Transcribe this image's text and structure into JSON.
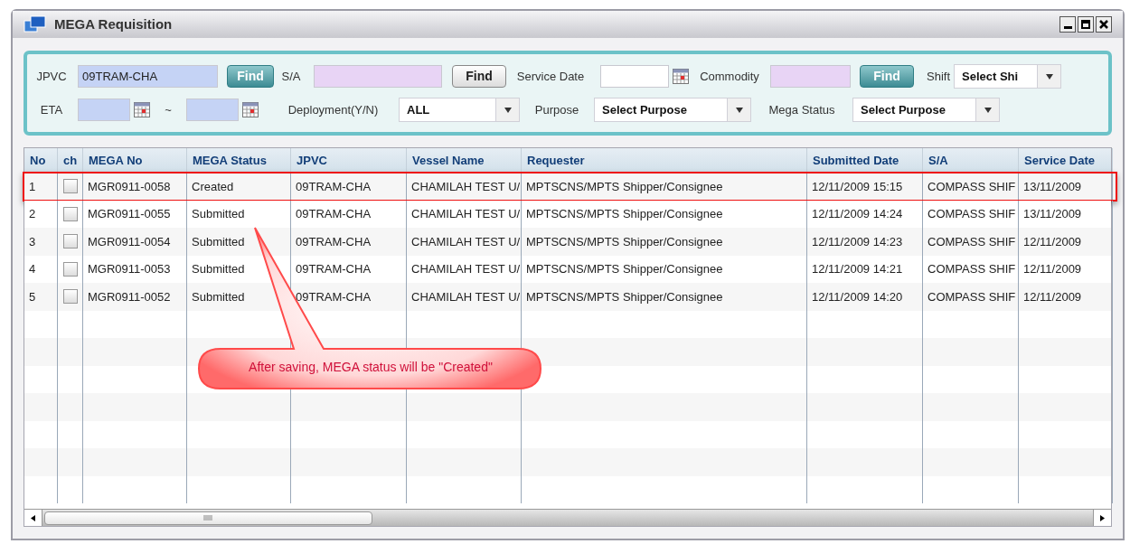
{
  "window": {
    "title": "MEGA Requisition"
  },
  "filters": [
    [
      {
        "kind": "label",
        "text": "JPVC"
      },
      {
        "kind": "input",
        "value": "09TRAM-CHA",
        "color": "#c5d3f5"
      },
      {
        "kind": "accent",
        "text": "Find"
      },
      {
        "kind": "label",
        "text": "S/A"
      },
      {
        "kind": "input",
        "color": "#e8d4f5"
      },
      {
        "kind": "button",
        "text": "Find"
      },
      {
        "kind": "label",
        "text": "Service Date"
      },
      {
        "kind": "date",
        "color": "#ffffff"
      },
      {
        "kind": "label",
        "text": "Commodity"
      },
      {
        "kind": "input",
        "color": "#e8d4f5"
      },
      {
        "kind": "accent",
        "text": "Find"
      },
      {
        "kind": "label",
        "text": "Shift"
      },
      {
        "kind": "select",
        "value": "Select Shi"
      }
    ],
    [
      {
        "kind": "label",
        "text": "ETA"
      },
      {
        "kind": "date",
        "color": "#c5d3f5"
      },
      {
        "kind": "label",
        "text": "~"
      },
      {
        "kind": "date",
        "color": "#c5d3f5"
      },
      {
        "kind": "label",
        "text": "Deployment(Y/N)"
      },
      {
        "kind": "select",
        "value": "ALL"
      },
      {
        "kind": "label",
        "text": "Purpose"
      },
      {
        "kind": "select",
        "value": "Select Purpose"
      },
      {
        "kind": "label",
        "text": "Mega Status"
      },
      {
        "kind": "select",
        "value": "Select Purpose"
      }
    ]
  ],
  "table": {
    "columns": [
      "No",
      "ch",
      "MEGA No",
      "MEGA Status",
      "JPVC",
      "Vessel Name",
      "Requester",
      "Submitted Date",
      "S/A",
      "Service Date"
    ],
    "rows": [
      {
        "cells": [
          "1",
          "",
          "MGR0911-0058",
          "Created",
          "09TRAM-CHA",
          "CHAMILAH TEST U/",
          "MPTSCNS/MPTS Shipper/Consignee",
          "12/11/2009 15:15",
          "COMPASS SHIF",
          "13/11/2009"
        ],
        "checked": false,
        "highlighted": true
      },
      {
        "cells": [
          "2",
          "",
          "MGR0911-0055",
          "Submitted",
          "09TRAM-CHA",
          "CHAMILAH TEST U/",
          "MPTSCNS/MPTS Shipper/Consignee",
          "12/11/2009 14:24",
          "COMPASS SHIF",
          "13/11/2009"
        ],
        "checked": false,
        "highlighted": false
      },
      {
        "cells": [
          "3",
          "",
          "MGR0911-0054",
          "Submitted",
          "09TRAM-CHA",
          "CHAMILAH TEST U/",
          "MPTSCNS/MPTS Shipper/Consignee",
          "12/11/2009 14:23",
          "COMPASS SHIF",
          "12/11/2009"
        ],
        "checked": false,
        "highlighted": false
      },
      {
        "cells": [
          "4",
          "",
          "MGR0911-0053",
          "Submitted",
          "09TRAM-CHA",
          "CHAMILAH TEST U/",
          "MPTSCNS/MPTS Shipper/Consignee",
          "12/11/2009 14:21",
          "COMPASS SHIF",
          "12/11/2009"
        ],
        "checked": false,
        "highlighted": false
      },
      {
        "cells": [
          "5",
          "",
          "MGR0911-0052",
          "Submitted",
          "09TRAM-CHA",
          "CHAMILAH TEST U/",
          "MPTSCNS/MPTS Shipper/Consignee",
          "12/11/2009 14:20",
          "COMPASS SHIF",
          "12/11/2009"
        ],
        "checked": false,
        "highlighted": false
      }
    ]
  },
  "annotation": {
    "text": "After saving, MEGA status will be \"Created\""
  }
}
